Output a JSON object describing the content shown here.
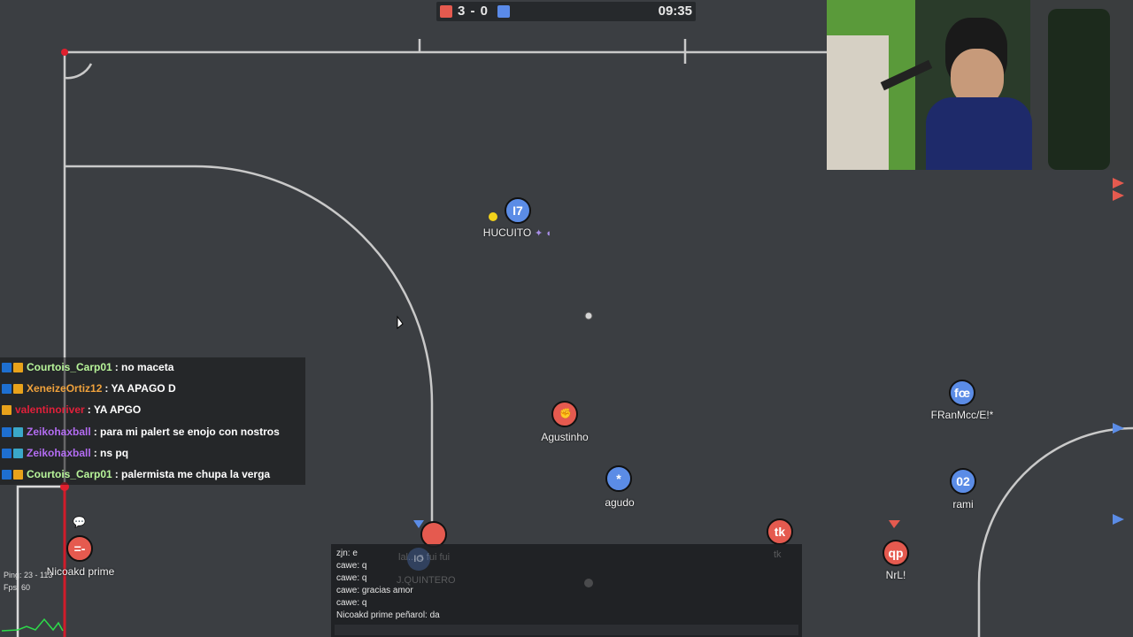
{
  "scoreboard": {
    "score": "3 - 0",
    "timer": "09:35",
    "colors": {
      "red": "#e55a4f",
      "blue": "#5a8ae8"
    }
  },
  "players": [
    {
      "id": "hucuito",
      "avatar": "I7",
      "name": "HUCUITO",
      "team": "blue"
    },
    {
      "id": "agustinho",
      "avatar": "",
      "name": "Agustinho",
      "team": "red"
    },
    {
      "id": "agudo",
      "avatar": "*",
      "name": "agudo",
      "team": "blue"
    },
    {
      "id": "franmcc",
      "avatar": "fœ",
      "name": "FRanMcc/E!*",
      "team": "blue"
    },
    {
      "id": "rami",
      "avatar": "02",
      "name": "rami",
      "team": "blue"
    },
    {
      "id": "tk",
      "avatar": "tk",
      "name": "tk",
      "team": "red"
    },
    {
      "id": "nrl",
      "avatar": "qp",
      "name": "NrL!",
      "team": "red"
    },
    {
      "id": "nicoakd",
      "avatar": "=-",
      "name": "Nicoakd prime",
      "team": "red"
    },
    {
      "id": "quintero",
      "avatar": "IO",
      "name": "J.QUINTERO",
      "team": "blue"
    }
  ],
  "overlay_chat": [
    {
      "user": "Courtois_Carp01",
      "color": "#b8f59a",
      "message": ": no maceta"
    },
    {
      "user": "XeneizeOrtiz12",
      "color": "#f0a23c",
      "message": ": YA APAGO D"
    },
    {
      "user": "valentinoriver",
      "color": "#e0203a",
      "message": ": YA APGO"
    },
    {
      "user": "Zeikohaxball",
      "color": "#b36cf2",
      "message": ": para mi palert se enojo con nostros"
    },
    {
      "user": "Zeikohaxball",
      "color": "#b36cf2",
      "message": ": ns pq"
    },
    {
      "user": "Courtois_Carp01",
      "color": "#b8f59a",
      "message": ": palermista me chupa la verga"
    }
  ],
  "game_chat": [
    "zjn: e",
    "cawe: q",
    "cawe: q",
    "cawe: gracias amor",
    "cawe: q",
    "Nicoakd prime peñarol: da"
  ],
  "faded_label": "lal... s fui fui",
  "stats": {
    "ping": "Ping: 23 - 113",
    "fps": "Fps: 60"
  }
}
